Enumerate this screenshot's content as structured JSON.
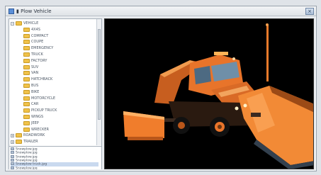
{
  "window": {
    "title": "▮ Plow Vehicle",
    "close_glyph": "×"
  },
  "tree": {
    "items": [
      {
        "label": "VEHICLE",
        "expander": "−"
      },
      {
        "label": "4X4S"
      },
      {
        "label": "COMPACT"
      },
      {
        "label": "COUPE"
      },
      {
        "label": "EMERGENCY"
      },
      {
        "label": "TRUCK"
      },
      {
        "label": "FACTORY"
      },
      {
        "label": "SUV"
      },
      {
        "label": "VAN"
      },
      {
        "label": "HATCHBACK"
      },
      {
        "label": "BUS"
      },
      {
        "label": "BIKE"
      },
      {
        "label": "MOTORCYCLE"
      },
      {
        "label": "CAR"
      },
      {
        "label": "PICKUP TRUCK"
      },
      {
        "label": "WINGS"
      },
      {
        "label": "JEEP"
      },
      {
        "label": "WRECKER"
      },
      {
        "label": "ROADWORK",
        "expander": "+"
      },
      {
        "label": "TRAILER",
        "expander": "+"
      }
    ]
  },
  "files": {
    "items": [
      {
        "label": "Snowplow.jpg"
      },
      {
        "label": "Snowplow.jpg"
      },
      {
        "label": "Snowplow.jpg"
      },
      {
        "label": "Snowplow.jpg"
      },
      {
        "label": "Snowplow truck.jpg"
      },
      {
        "label": "Snowplow.jpg"
      }
    ]
  },
  "viewport": {
    "background": "#000000",
    "body_color": "#e8742a",
    "plow_color": "#f28a36",
    "glass_color": "#6f8fa8"
  }
}
